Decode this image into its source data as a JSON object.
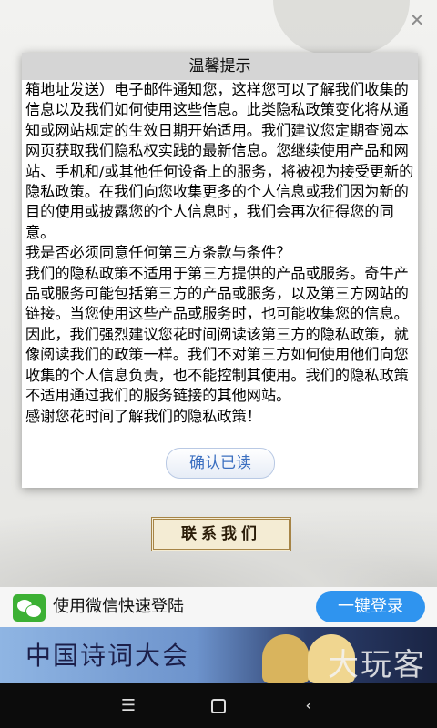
{
  "dialog": {
    "title": "温馨提示",
    "paragraphs": [
      "箱地址发送）电子邮件通知您，这样您可以了解我们收集的信息以及我们如何使用这些信息。此类隐私政策变化将从通知或网站规定的生效日期开始适用。我们建议您定期查阅本网页获取我们隐私权实践的最新信息。您继续使用产品和网站、手机和/或其他任何设备上的服务，将被视为接受更新的隐私政策。在我们向您收集更多的个人信息或我们因为新的目的使用或披露您的个人信息时，我们会再次征得您的同意。",
      "我是否必须同意任何第三方条款与条件？",
      "我们的隐私政策不适用于第三方提供的产品或服务。奇牛产品或服务可能包括第三方的产品或服务，以及第三方网站的链接。当您使用这些产品或服务时，也可能收集您的信息。因此，我们强烈建议您花时间阅读该第三方的隐私政策，就像阅读我们的政策一样。我们不对第三方如何使用他们向您收集的个人信息负责，也不能控制其使用。我们的隐私政策不适用通过我们的服务链接的其他网站。",
      "感谢您花时间了解我们的隐私政策！"
    ],
    "confirm_label": "确认已读"
  },
  "contact_label": "联系我们",
  "wechat_bar": {
    "icon": "wechat-icon",
    "label": "使用微信快速登陆",
    "login_label": "一键登录"
  },
  "banner": {
    "title": "中国诗词大会",
    "watermark": "大玩客"
  },
  "navbar": {
    "menu_icon": "menu-icon",
    "home_icon": "home-icon",
    "back_icon": "back-icon"
  },
  "colors": {
    "accent_blue": "#2f94ef",
    "wechat_green": "#3cb034",
    "confirm_text": "#3b6fc0"
  }
}
